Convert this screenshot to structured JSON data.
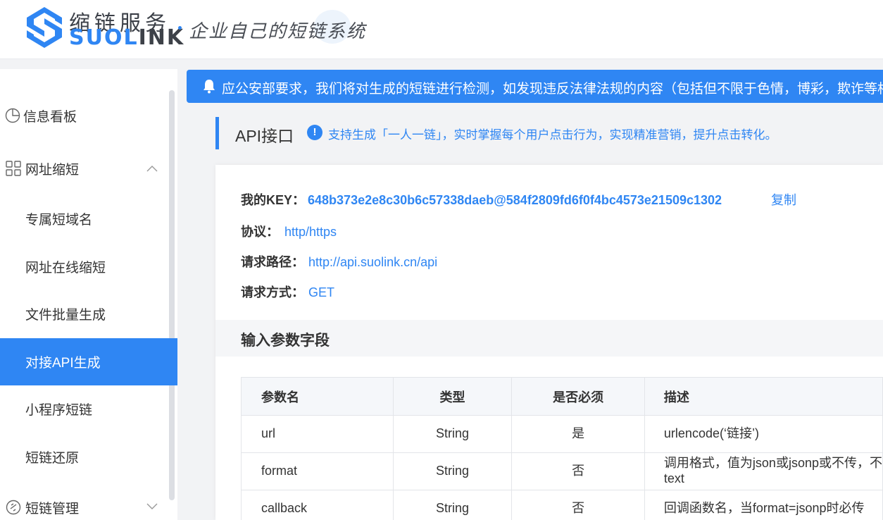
{
  "header": {
    "brand_cn": "缩链服务",
    "brand_en_blue": "SUOL",
    "brand_en_dark": "INK",
    "slogan": "企业自己的短链系统",
    "colors": {
      "brand_blue": "#2f86f3",
      "dark": "#3d4148"
    }
  },
  "sidebar": {
    "items": [
      {
        "label": "信息看板",
        "icon": "pie-chart-icon"
      },
      {
        "label": "网址缩短",
        "icon": "grid-icon",
        "expanded": true
      },
      {
        "label": "专属短域名"
      },
      {
        "label": "网址在线缩短"
      },
      {
        "label": "文件批量生成"
      },
      {
        "label": "对接API生成",
        "active": true
      },
      {
        "label": "小程序短链"
      },
      {
        "label": "短链还原"
      },
      {
        "label": "短链管理",
        "icon": "link-icon",
        "expanded": false
      }
    ]
  },
  "notice": {
    "text": "应公安部要求，我们将对生成的短链进行检测，如发现违反法律法规的内容（包括但不限于色情，博彩，欺诈等相"
  },
  "section": {
    "title": "API接口",
    "tip": "支持生成「一人一链」，实时掌握每个用户点击行为，实现精准营销，提升点击转化。"
  },
  "api": {
    "key_label": "我的KEY：",
    "key_value": "648b373e2e8c30b6c57338daeb@584f2809fd6f0f4bc4573e21509c1302",
    "copy_label": "复制",
    "protocol_label": "协议：",
    "protocol_value": "http/https",
    "path_label": "请求路径：",
    "path_value": "http://api.suolink.cn/api",
    "method_label": "请求方式：",
    "method_value": "GET"
  },
  "input_params": {
    "heading": "输入参数字段",
    "columns": [
      "参数名",
      "类型",
      "是否必须",
      "描述"
    ],
    "rows": [
      {
        "name": "url",
        "type": "String",
        "required": "是",
        "desc": "urlencode(‘链接’)",
        "desc2": ""
      },
      {
        "name": "format",
        "type": "String",
        "required": "否",
        "desc": "调用格式，值为json或jsonp或不传，不",
        "desc2": "text"
      },
      {
        "name": "callback",
        "type": "String",
        "required": "否",
        "desc": "回调函数名，当format=jsonp时必传",
        "desc2": ""
      }
    ]
  }
}
